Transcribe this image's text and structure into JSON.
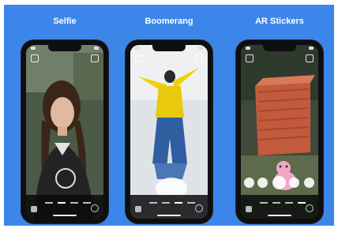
{
  "panels": [
    {
      "title": "Selfie"
    },
    {
      "title": "Boomerang"
    },
    {
      "title": "AR Stickers"
    }
  ],
  "colors": {
    "background": "#3d86e9",
    "phone": "#0f0f12"
  }
}
